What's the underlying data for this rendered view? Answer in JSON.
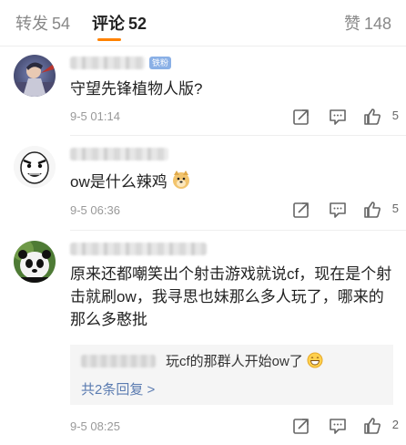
{
  "tabs": {
    "repost_label": "转发",
    "repost_count": "54",
    "comment_label": "评论",
    "comment_count": "52",
    "like_label": "赞",
    "like_count": "148"
  },
  "comments": [
    {
      "badge": "铁粉",
      "text": "守望先锋植物人版?",
      "time": "9-5 01:14",
      "likes": "5"
    },
    {
      "text": "ow是什么辣鸡",
      "emoji": "doge-icon",
      "time": "9-5 06:36",
      "likes": "5"
    },
    {
      "text": "原来还都嘲笑出个射击游戏就说cf，现在是个射击就刷ow，我寻思也妹那么多人玩了，哪来的那么多憨批",
      "time": "9-5 08:25",
      "likes": "2",
      "reply": {
        "text": "玩cf的那群人开始ow了",
        "emoji": "grin-icon",
        "more": "共2条回复 >"
      }
    }
  ],
  "colors": {
    "accent": "#ff8200",
    "link": "#5b7cb1",
    "muted": "#999999"
  }
}
